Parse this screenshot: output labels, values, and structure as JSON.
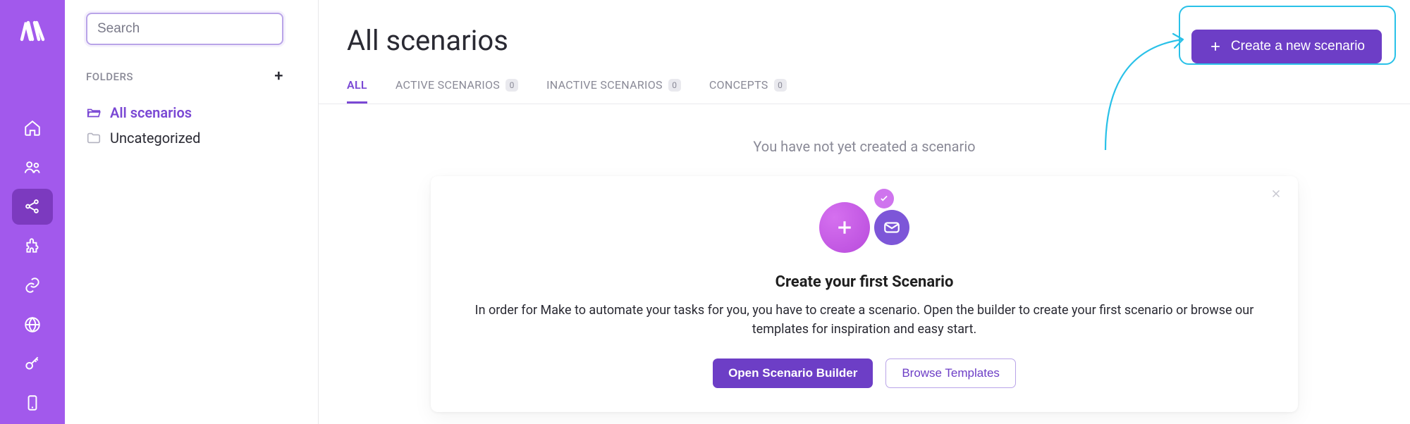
{
  "search": {
    "placeholder": "Search"
  },
  "folders": {
    "heading": "FOLDERS",
    "items": [
      {
        "label": "All scenarios",
        "selected": true
      },
      {
        "label": "Uncategorized",
        "selected": false
      }
    ]
  },
  "header": {
    "title": "All scenarios",
    "create_button": "Create a new scenario"
  },
  "tabs": [
    {
      "label": "ALL",
      "count": null,
      "active": true
    },
    {
      "label": "ACTIVE SCENARIOS",
      "count": "0",
      "active": false
    },
    {
      "label": "INACTIVE SCENARIOS",
      "count": "0",
      "active": false
    },
    {
      "label": "CONCEPTS",
      "count": "0",
      "active": false
    }
  ],
  "empty_hint": "You have not yet created a scenario",
  "onboarding": {
    "title": "Create your first Scenario",
    "body": "In order for Make to automate your tasks for you, you have to create a scenario. Open the builder to create your first scenario or browse our templates for inspiration and easy start.",
    "primary": "Open Scenario Builder",
    "secondary": "Browse Templates"
  },
  "icons": {
    "rail": [
      "home",
      "users",
      "share",
      "puzzle",
      "link",
      "globe",
      "key",
      "phone"
    ]
  },
  "colors": {
    "brand_purple": "#a259ec",
    "accent_purple": "#6d3ec6",
    "annotation_cyan": "#29c1e8"
  }
}
